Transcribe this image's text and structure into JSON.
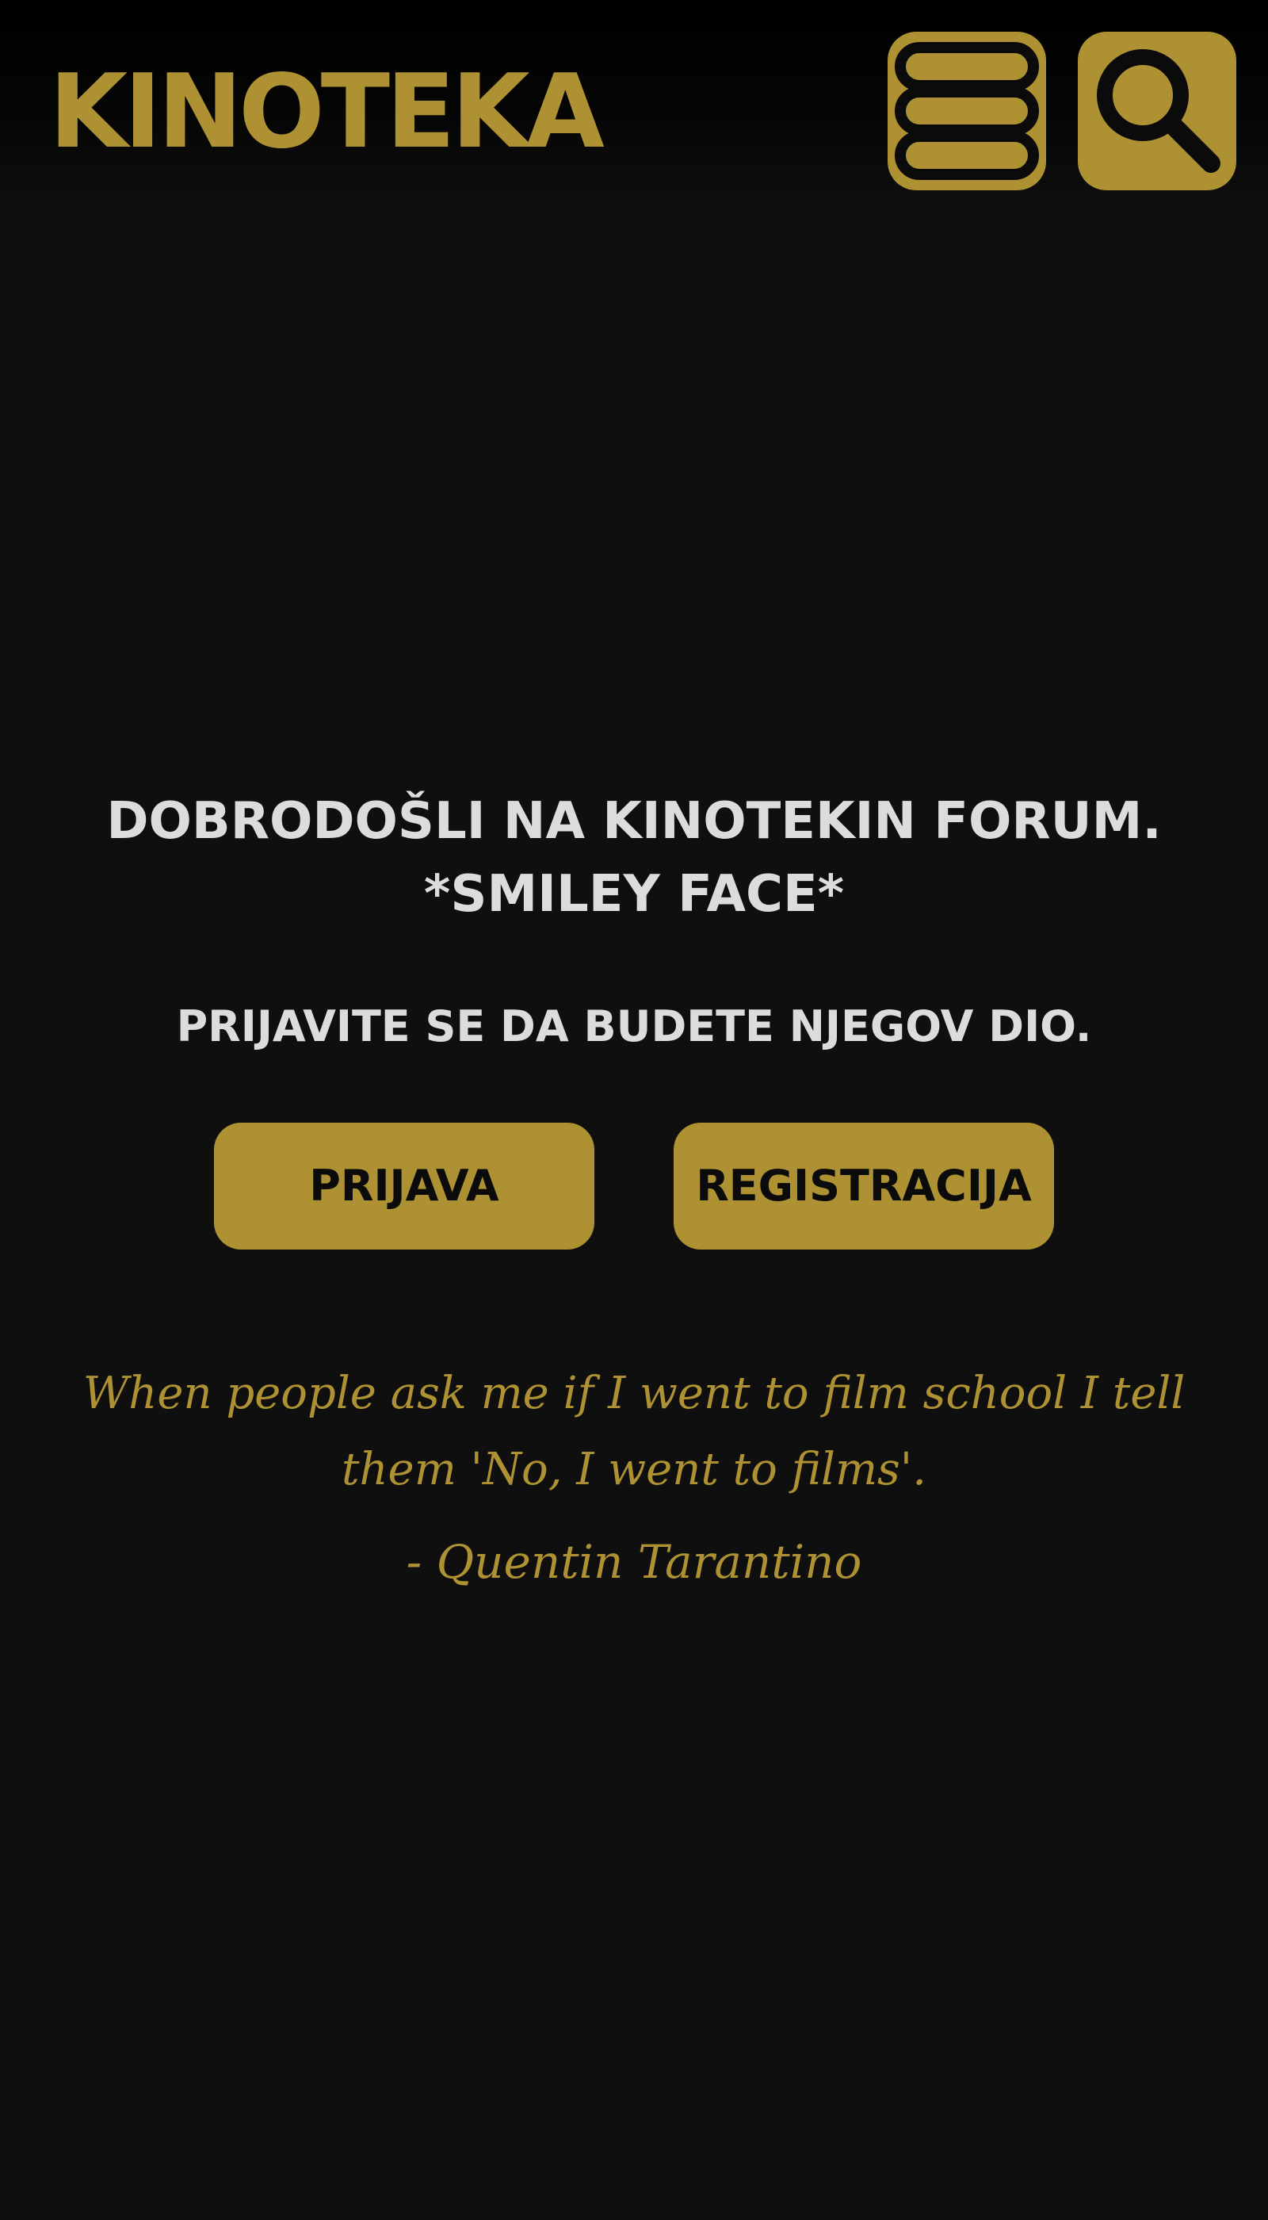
{
  "header": {
    "logo_text": "KINOTEKA",
    "menu_icon": "hamburger-menu-icon",
    "search_icon": "search-icon"
  },
  "hero": {
    "headline_line1": "DOBRODOŠLI NA KINOTEKIN FORUM.",
    "headline_line2": "*SMILEY FACE*",
    "subline": "PRIJAVITE SE DA BUDETE NJEGOV DIO."
  },
  "actions": {
    "login_label": "PRIJAVA",
    "register_label": "REGISTRACIJA"
  },
  "quote": {
    "text": "When people ask me if I went to film school I tell them 'No, I went to films'.",
    "author": "- Quentin Tarantino"
  },
  "colors": {
    "accent": "#ad9132",
    "background": "#0f0f0f",
    "header_background": "#000000",
    "text_light": "#dcdcdc",
    "button_text": "#0b0b0b"
  }
}
